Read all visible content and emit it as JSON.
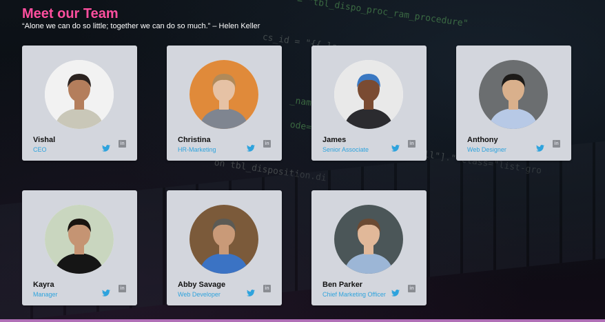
{
  "header": {
    "title": "Meet our Team",
    "quote": "“Alone we can do so little; together we can do so much.” – Helen Keller"
  },
  "colors": {
    "title": "#ff4f9f",
    "role": "#2ea3dd",
    "card": "#d3d6dd"
  },
  "members": [
    {
      "name": "Vishal",
      "role": "CEO",
      "avatar_bg": "#f2f2f2",
      "shirt": "#c9c7b8",
      "hair": "#2b2320",
      "skin": "#b47e5c"
    },
    {
      "name": "Christina",
      "role": "HR-Marketing",
      "avatar_bg": "#e08a3a",
      "shirt": "#7f8590",
      "hair": "#b08a5a",
      "skin": "#e6c2a5"
    },
    {
      "name": "James",
      "role": "Senior Associate",
      "avatar_bg": "#e9e9e9",
      "shirt": "#2b2b2f",
      "hair": "#3a78c2",
      "skin": "#7a4b32"
    },
    {
      "name": "Anthony",
      "role": "Web Designer",
      "avatar_bg": "#6b6e70",
      "shirt": "#b7c9e6",
      "hair": "#1c1a18",
      "skin": "#d9b08c"
    },
    {
      "name": "Kayra",
      "role": "Manager",
      "avatar_bg": "#c9d6bf",
      "shirt": "#151515",
      "hair": "#1a1410",
      "skin": "#c59473"
    },
    {
      "name": "Abby Savage",
      "role": "Web Developer",
      "avatar_bg": "#7b5a3a",
      "shirt": "#3b73c4",
      "hair": "#5c5a54",
      "skin": "#c99a78"
    },
    {
      "name": "Ben Parker",
      "role": "Chief Marketing Officer",
      "avatar_bg": "#4b5658",
      "shirt": "#9cb6d6",
      "hair": "#6b4a33",
      "skin": "#e1b899"
    }
  ],
  "icons": {
    "twitter": "twitter-icon",
    "linkedin": "linkedin-icon",
    "linkedin_glyph": "in"
  }
}
